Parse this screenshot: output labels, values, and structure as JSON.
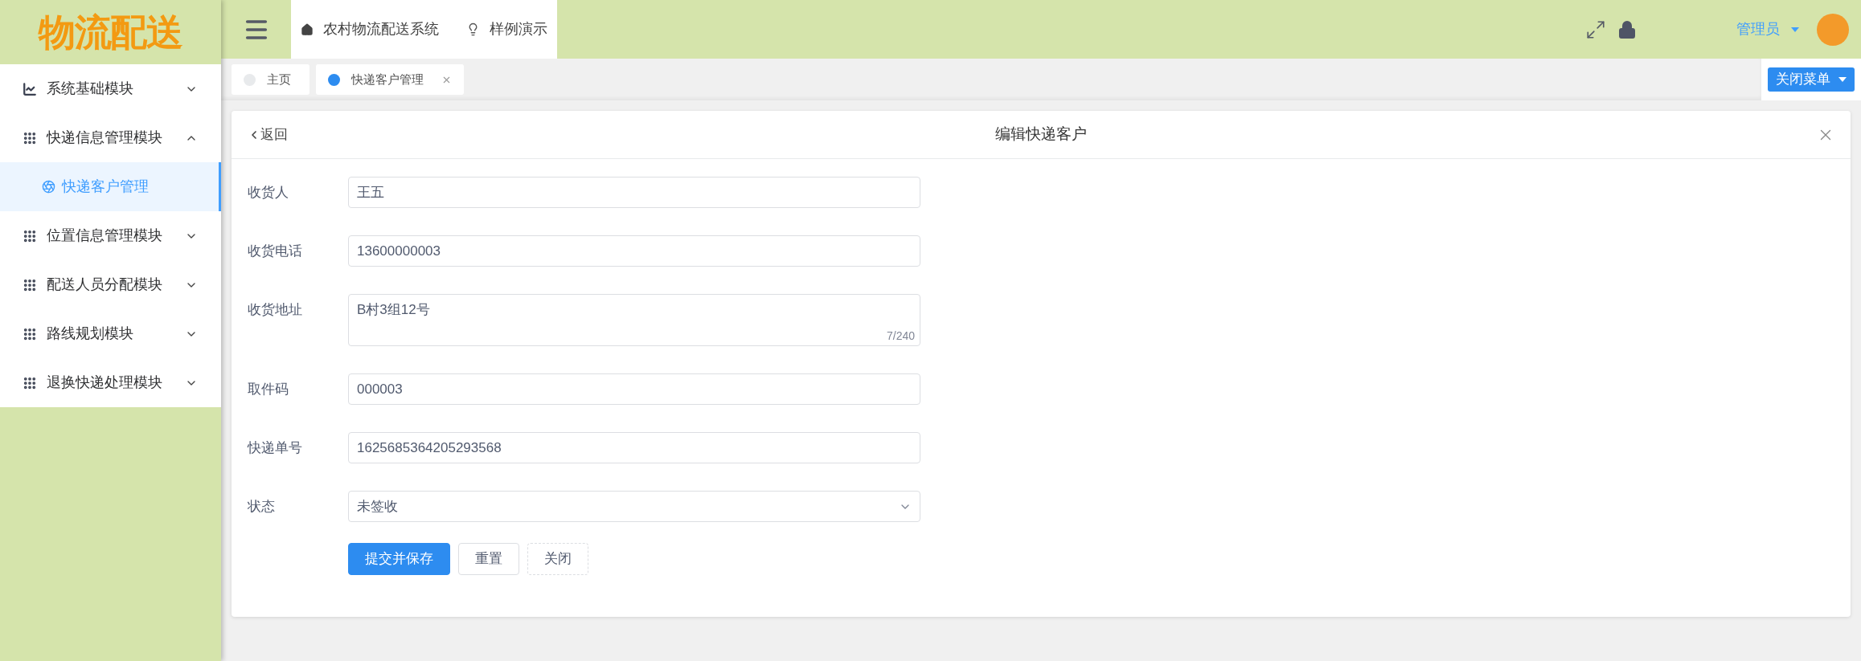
{
  "logo": "物流配送",
  "header": {
    "links": [
      "农村物流配送系统",
      "样例演示"
    ],
    "user": "管理员"
  },
  "sidebar": {
    "items": [
      {
        "label": "系统基础模块",
        "expanded": false
      },
      {
        "label": "快递信息管理模块",
        "expanded": true,
        "children": [
          {
            "label": "快递客户管理",
            "selected": true
          }
        ]
      },
      {
        "label": "位置信息管理模块",
        "expanded": false
      },
      {
        "label": "配送人员分配模块",
        "expanded": false
      },
      {
        "label": "路线规划模块",
        "expanded": false
      },
      {
        "label": "退换快递处理模块",
        "expanded": false
      }
    ]
  },
  "tabs": [
    {
      "label": "主页",
      "selected": false,
      "closable": false
    },
    {
      "label": "快递客户管理",
      "selected": true,
      "closable": true
    }
  ],
  "close_menu": "关闭菜单",
  "panel": {
    "back": "返回",
    "title": "编辑快递客户",
    "fields": [
      {
        "kind": "input",
        "label": "收货人",
        "value": "王五"
      },
      {
        "kind": "input",
        "label": "收货电话",
        "value": "13600000003"
      },
      {
        "kind": "textarea",
        "label": "收货地址",
        "value": "B村3组12号",
        "counter": "7/240"
      },
      {
        "kind": "input",
        "label": "取件码",
        "value": "000003"
      },
      {
        "kind": "input",
        "label": "快递单号",
        "value": "1625685364205293568"
      },
      {
        "kind": "select",
        "label": "状态",
        "value": "未签收"
      }
    ],
    "buttons": [
      {
        "kind": "primary",
        "label": "提交并保存"
      },
      {
        "kind": "default",
        "label": "重置"
      },
      {
        "kind": "dashed",
        "label": "关闭"
      }
    ]
  }
}
